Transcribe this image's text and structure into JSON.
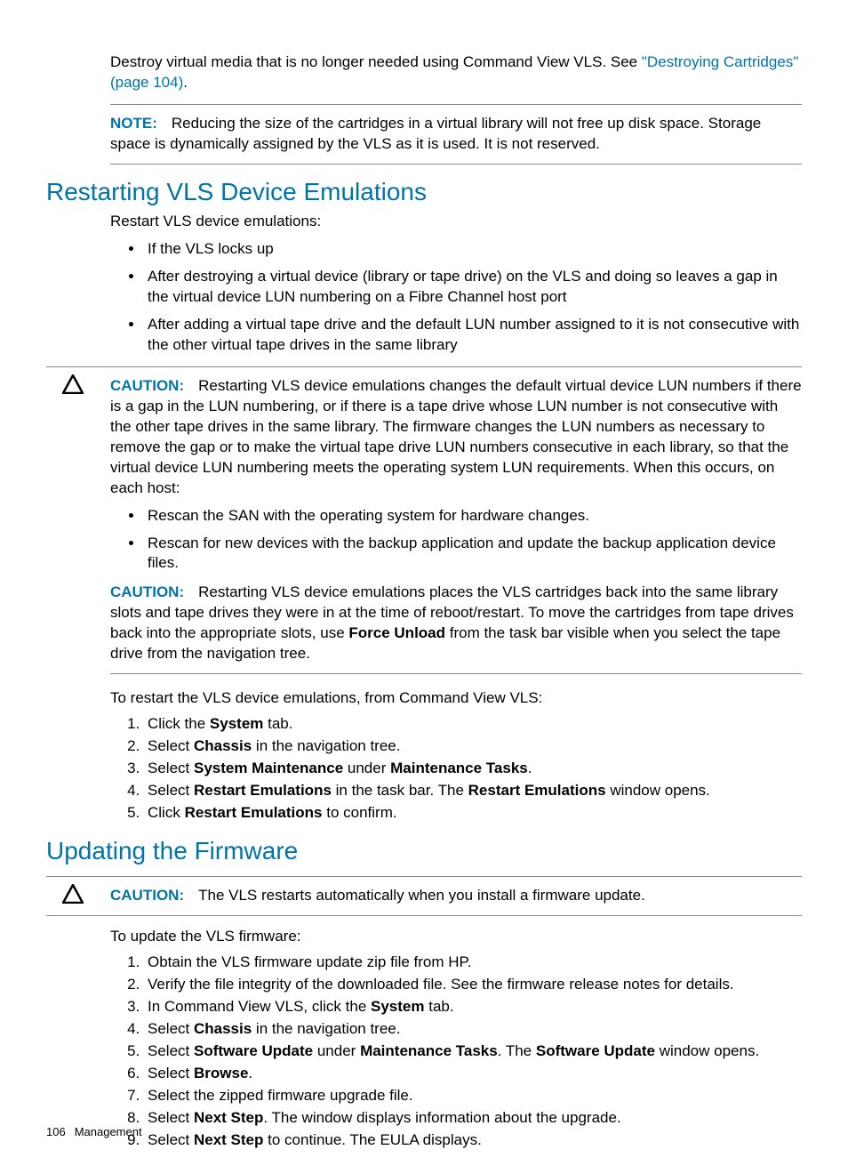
{
  "intro": {
    "para1_a": "Destroy virtual media that is no longer needed using Command View VLS. See ",
    "link_text": "\"Destroying Cartridges\" (page 104)",
    "para1_b": "."
  },
  "note1": {
    "label": "NOTE:",
    "text": "Reducing the size of the cartridges in a virtual library will not free up disk space. Storage space is dynamically assigned by the VLS as it is used. It is not reserved."
  },
  "section1": {
    "heading": "Restarting VLS Device Emulations",
    "lead": "Restart VLS device emulations:",
    "bullets": [
      "If the VLS locks up",
      "After destroying a virtual device (library or tape drive) on the VLS and doing so leaves a gap in the virtual device LUN numbering on a Fibre Channel host port",
      "After adding a virtual tape drive and the default LUN number assigned to it is not consecutive with the other virtual tape drives in the same library"
    ],
    "caution1": {
      "label": "CAUTION:",
      "text": "Restarting VLS device emulations changes the default virtual device LUN numbers if there is a gap in the LUN numbering, or if there is a tape drive whose LUN number is not consecutive with the other tape drives in the same library. The firmware changes the LUN numbers as necessary to remove the gap or to make the virtual tape drive LUN numbers consecutive in each library, so that the virtual device LUN numbering meets the operating system LUN requirements. When this occurs, on each host:",
      "bullets": [
        "Rescan the SAN with the operating system for hardware changes.",
        "Rescan for new devices with the backup application and update the backup application device files."
      ]
    },
    "caution2": {
      "label": "CAUTION:",
      "pre": "Restarting VLS device emulations places the VLS cartridges back into the same library slots and tape drives they were in at the time of reboot/restart. To move the cartridges from tape drives back into the appropriate slots, use ",
      "bold": "Force Unload",
      "post": " from the task bar visible when you select the tape drive from the navigation tree."
    },
    "procedure_lead": "To restart the VLS device emulations, from Command View VLS:",
    "steps": [
      {
        "pre": "Click the ",
        "b1": "System",
        "post": " tab."
      },
      {
        "pre": "Select ",
        "b1": "Chassis",
        "post": " in the navigation tree."
      },
      {
        "pre": "Select ",
        "b1": "System Maintenance",
        "mid": " under ",
        "b2": "Maintenance Tasks",
        "post": "."
      },
      {
        "pre": "Select ",
        "b1": "Restart Emulations",
        "mid": " in the task bar. The ",
        "b2": "Restart Emulations",
        "post": " window opens."
      },
      {
        "pre": "Click ",
        "b1": "Restart Emulations",
        "post": " to confirm."
      }
    ]
  },
  "section2": {
    "heading": "Updating the Firmware",
    "caution": {
      "label": "CAUTION:",
      "text": "The VLS restarts automatically when you install a firmware update."
    },
    "procedure_lead": "To update the VLS firmware:",
    "steps": [
      {
        "pre": "Obtain the VLS firmware update zip file from HP."
      },
      {
        "pre": "Verify the file integrity of the downloaded file. See the firmware release notes for details."
      },
      {
        "pre": "In Command View VLS, click the ",
        "b1": "System",
        "post": " tab."
      },
      {
        "pre": "Select ",
        "b1": "Chassis",
        "post": " in the navigation tree."
      },
      {
        "pre": "Select ",
        "b1": "Software Update",
        "mid": " under ",
        "b2": "Maintenance Tasks",
        "post2_pre": ". The ",
        "b3": "Software Update",
        "post": " window opens."
      },
      {
        "pre": "Select ",
        "b1": "Browse",
        "post": "."
      },
      {
        "pre": "Select the zipped firmware upgrade file."
      },
      {
        "pre": "Select ",
        "b1": "Next Step",
        "post": ". The window displays information about the upgrade."
      },
      {
        "pre": "Select ",
        "b1": "Next Step",
        "post": " to continue. The EULA displays."
      }
    ]
  },
  "footer": {
    "page": "106",
    "section": "Management"
  }
}
